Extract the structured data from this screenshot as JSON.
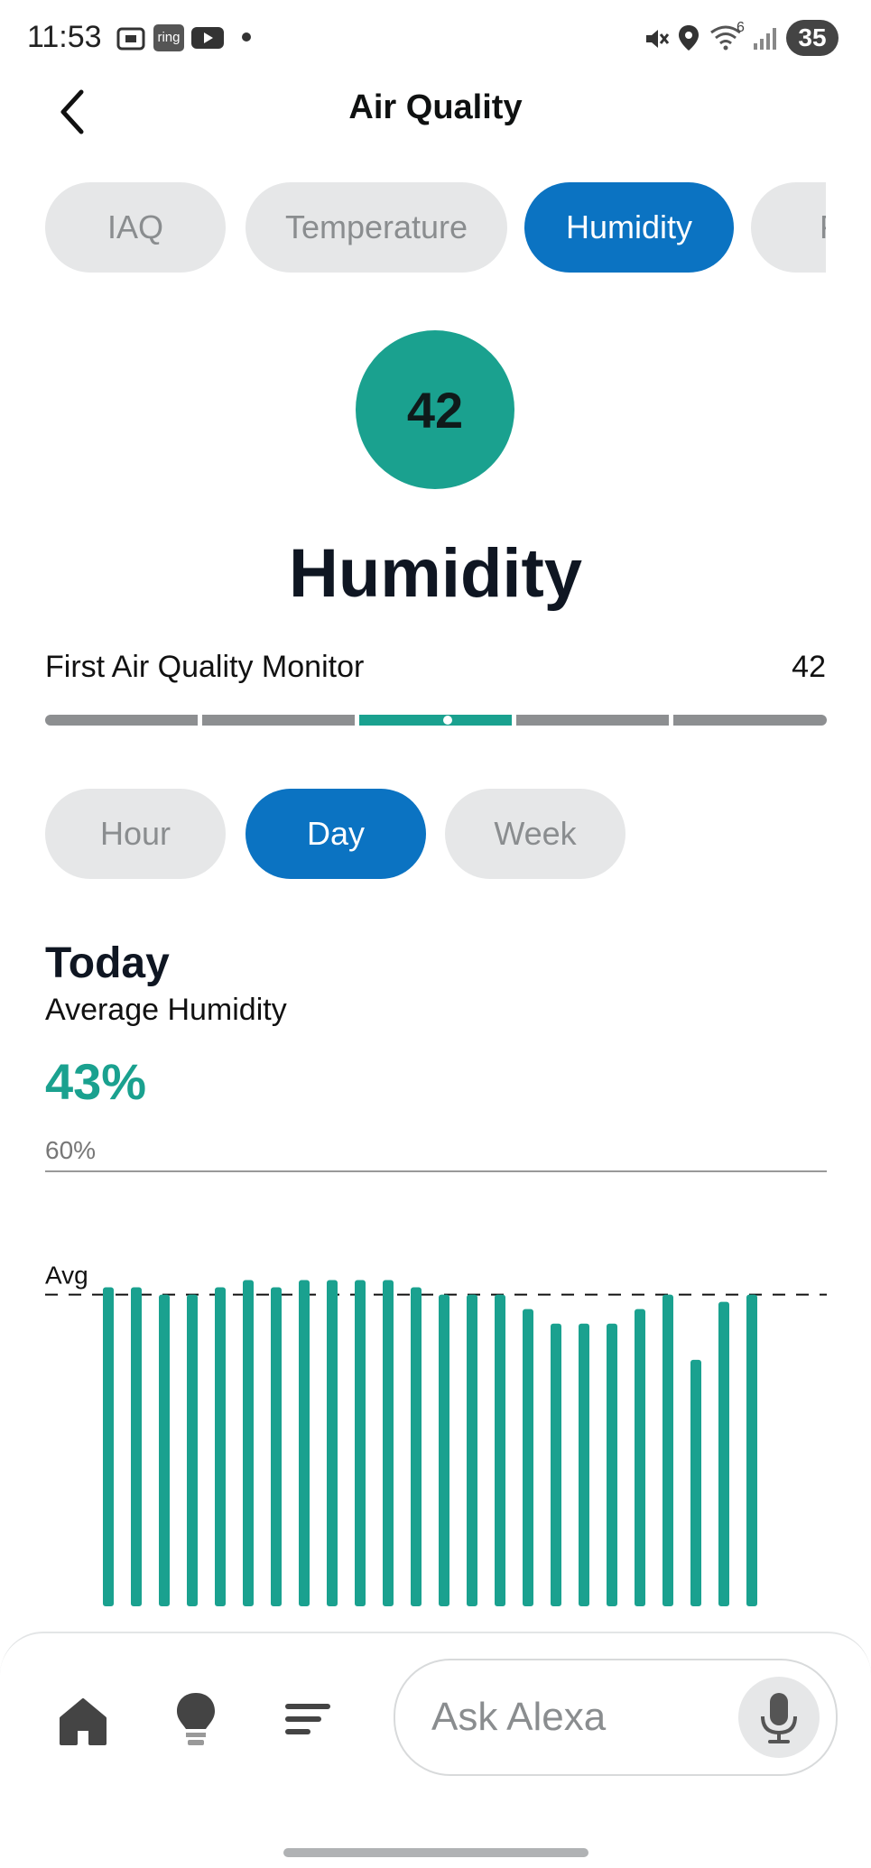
{
  "status_bar": {
    "time": "11:53",
    "ring_label": "ring",
    "wifi_badge": "6",
    "battery": "35"
  },
  "header": {
    "title": "Air Quality"
  },
  "tabs": [
    {
      "label": "IAQ",
      "active": false
    },
    {
      "label": "Temperature",
      "active": false
    },
    {
      "label": "Humidity",
      "active": true
    },
    {
      "label": "P",
      "active": false
    }
  ],
  "current": {
    "value": "42",
    "metric": "Humidity",
    "device": "First Air Quality Monitor",
    "device_value": "42",
    "scale_segment": 3,
    "scale_segments": 5
  },
  "ranges": [
    {
      "label": "Hour",
      "active": false
    },
    {
      "label": "Day",
      "active": true
    },
    {
      "label": "Week",
      "active": false
    }
  ],
  "summary": {
    "period": "Today",
    "label": "Average Humidity",
    "value": "43%"
  },
  "chart_data": {
    "type": "bar",
    "y_top_label": "60%",
    "ylim": [
      0,
      60
    ],
    "avg_label": "Avg",
    "avg_value": 43,
    "values": [
      44,
      44,
      43,
      43,
      44,
      45,
      44,
      45,
      45,
      45,
      45,
      44,
      43,
      43,
      43,
      41,
      39,
      39,
      39,
      41,
      43,
      34,
      42,
      43
    ],
    "color": "#1aa18f"
  },
  "bottom_nav": {
    "ask_placeholder": "Ask Alexa"
  },
  "colors": {
    "accent": "#0b73c2",
    "teal": "#1aa18f",
    "chip_bg": "#e6e7e8",
    "scale_gray": "#8d8f91"
  },
  "icons": [
    "back-chevron-icon",
    "home-icon",
    "lightbulb-icon",
    "list-icon",
    "microphone-icon"
  ]
}
